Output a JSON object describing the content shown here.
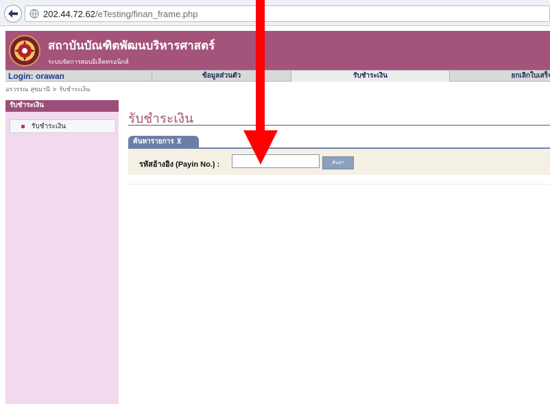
{
  "browser": {
    "url_host": "202.44.72.62",
    "url_path": "/eTesting/finan_frame.php"
  },
  "header": {
    "institution_name": "สถาบันบัณฑิตพัฒนบริหารศาสตร์",
    "system_name": "ระบบจัดการสอบอิเล็คทรอนิกส์",
    "background_color": "#a4537a"
  },
  "navbar": {
    "login_text": "Login: orawan",
    "tabs": [
      {
        "label": "ข้อมูลส่วนตัว"
      },
      {
        "label": "รับชำระเงิน",
        "active": true
      },
      {
        "label": "ยกเลิกใบเสร็จ"
      }
    ]
  },
  "breadcrumb": "อรวรรณ สุขมานี > รับชำระเงิน",
  "sidebar": {
    "heading": "รับชำระเงิน",
    "items": [
      {
        "label": "รับชำระเงิน"
      }
    ]
  },
  "main": {
    "page_title": "รับชำระเงิน",
    "search_tab_label": "ค้นหารายการ ⊻",
    "search_label": "รหัสอ้างอิง (Payin No.) :",
    "search_value": "",
    "search_button_label": "ค้นหา"
  },
  "annotation": {
    "arrow_color": "#ff0000",
    "arrow_icon": "red-down-arrow-icon"
  }
}
